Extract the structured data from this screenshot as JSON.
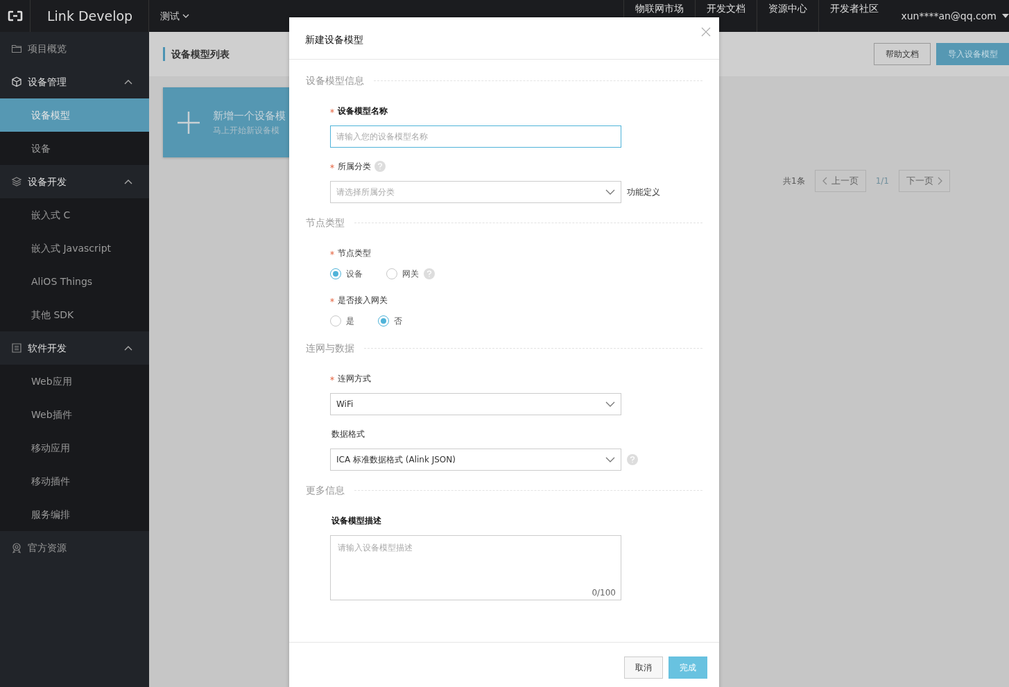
{
  "topbar": {
    "brand": "Link Develop",
    "project": "测试",
    "links": [
      "物联网市场",
      "开发文档",
      "资源中心",
      "开发者社区"
    ],
    "user": "xun****an@qq.com"
  },
  "sidebar": {
    "items": [
      {
        "label": "项目概览",
        "selected": false
      },
      {
        "label": "设备管理",
        "expanded": true,
        "selected": false,
        "children": [
          {
            "label": "设备模型",
            "selected": true
          },
          {
            "label": "设备",
            "selected": false
          }
        ]
      },
      {
        "label": "设备开发",
        "expanded": true,
        "selected": false,
        "children": [
          {
            "label": "嵌入式 C",
            "selected": false
          },
          {
            "label": "嵌入式 Javascript",
            "selected": false
          },
          {
            "label": "AliOS Things",
            "selected": false
          },
          {
            "label": "其他 SDK",
            "selected": false
          }
        ]
      },
      {
        "label": "软件开发",
        "expanded": true,
        "selected": false,
        "children": [
          {
            "label": "Web应用",
            "selected": false
          },
          {
            "label": "Web插件",
            "selected": false
          },
          {
            "label": "移动应用",
            "selected": false
          },
          {
            "label": "移动插件",
            "selected": false
          },
          {
            "label": "服务编排",
            "selected": false
          }
        ]
      },
      {
        "label": "官方资源",
        "selected": false
      }
    ]
  },
  "page": {
    "title": "设备模型列表",
    "buttons": [
      {
        "label": "帮助文档",
        "kind": "default"
      },
      {
        "label": "导入设备模型",
        "kind": "primary"
      }
    ],
    "new_card": {
      "title": "新增一个设备模",
      "subtitle": "马上开始新设备模"
    },
    "pagination": {
      "total": "共1条",
      "prev": {
        "label": "上一页",
        "disabled": true
      },
      "page": "1/1",
      "next": {
        "label": "下一页",
        "disabled": true
      }
    }
  },
  "modal": {
    "title": "新建设备模型",
    "sections": [
      {
        "title": "设备模型信息",
        "fields": [
          {
            "kind": "text",
            "label": "设备模型名称",
            "required": true,
            "bold": true,
            "placeholder": "请输入您的设备模型名称",
            "focused": true
          },
          {
            "kind": "select",
            "label": "所属分类",
            "required": true,
            "bold": false,
            "label_help": true,
            "placeholder": "请选择所属分类",
            "side_text": "功能定义"
          }
        ]
      },
      {
        "title": "节点类型",
        "fields": [
          {
            "kind": "radio",
            "label": "节点类型",
            "required": true,
            "bold": false,
            "options": [
              {
                "label": "设备",
                "selected": true,
                "help": false
              },
              {
                "label": "网关",
                "selected": false,
                "help": true
              }
            ]
          },
          {
            "kind": "radio",
            "label": "是否接入网关",
            "required": true,
            "bold": false,
            "options": [
              {
                "label": "是",
                "selected": false,
                "help": false
              },
              {
                "label": "否",
                "selected": true,
                "help": false
              }
            ]
          }
        ]
      },
      {
        "title": "连网与数据",
        "fields": [
          {
            "kind": "select",
            "label": "连网方式",
            "required": true,
            "bold": false,
            "value": "WiFi"
          },
          {
            "kind": "select",
            "label": "数据格式",
            "required": false,
            "bold": false,
            "value": "ICA 标准数据格式 (Alink JSON)",
            "help_after": true
          }
        ]
      },
      {
        "title": "更多信息",
        "fields": [
          {
            "kind": "textarea",
            "label": "设备模型描述",
            "required": false,
            "bold": true,
            "placeholder": "请输入设备模型描述",
            "counter": "0/100"
          }
        ]
      }
    ],
    "buttons": [
      {
        "label": "取消",
        "kind": "default"
      },
      {
        "label": "完成",
        "kind": "primary"
      }
    ]
  }
}
